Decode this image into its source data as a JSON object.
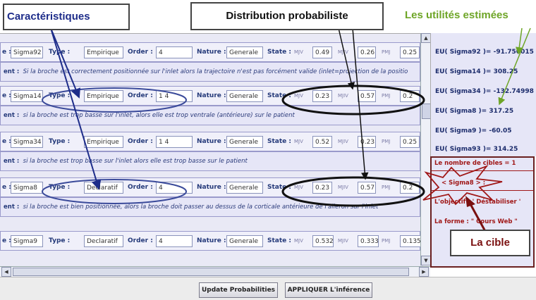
{
  "annotations": {
    "features": "Caractéristiques",
    "distribution": "Distribution probabiliste",
    "utilities": "Les utilités estimées",
    "target": "La cible"
  },
  "labels": {
    "name": "e :",
    "type": "Type :",
    "order": "Order :",
    "nature": "Nature :",
    "state": "State :",
    "mjv": "MJV",
    "mjiv": "MJIV",
    "pmj": "PMJ",
    "comment": "ent :"
  },
  "rows": [
    {
      "name": "Sigma92",
      "type": "Empirique",
      "order": "4",
      "nature": "Generale",
      "mjv": "0.49",
      "mjiv": "0.26",
      "pmj": "0.25",
      "comment": "Si la broche est correctement positionnée sur l'inlet alors la trajectoire n'est pas forcément valide (inlet=projection de la positio"
    },
    {
      "name": "Sigma14",
      "type": "Empirique",
      "order": "1 4",
      "nature": "Generale",
      "mjv": "0.23",
      "mjiv": "0.57",
      "pmj": "0.2",
      "comment": "si la broche est trop basse sur l'inlet, alors elle est trop ventrale (antérieure) sur le patient"
    },
    {
      "name": "Sigma34",
      "type": "Empirique",
      "order": "1 4",
      "nature": "Generale",
      "mjv": "0.52",
      "mjiv": "0.23",
      "pmj": "0.25",
      "comment": "si la broche est trop basse sur l'inlet alors elle est trop basse sur le patient"
    },
    {
      "name": "Sigma8",
      "type": "Declaratif",
      "order": "4",
      "nature": "Generale",
      "mjv": "0.23",
      "mjiv": "0.57",
      "pmj": "0.2",
      "comment": "si la broche est bien positionnée, alors la broche doit passer au dessus de la corticale antérieure de l'aileron sur l'inlet"
    },
    {
      "name": "Sigma9",
      "type": "Declaratif",
      "order": "4",
      "nature": "Generale",
      "mjv": "0.532",
      "mjiv": "0.333",
      "pmj": "0.135",
      "comment": ""
    }
  ],
  "utilities": [
    "EU( Sigma92 )= -91.750015",
    "EU( Sigma14 )= 308.25",
    "EU( Sigma34 )= -132.74998",
    "EU( Sigma8 )= 317.25",
    "EU( Sigma9 )= -60.05",
    "EU( Sigma93 )= 314.25"
  ],
  "target_panel": {
    "count": "Le nombre de cibles = 1",
    "sigma": "< Sigma8 > :",
    "objective": "L'objectif : ' Déstabiliser '",
    "form": "La forme : \" Cours Web \""
  },
  "buttons": {
    "update": "Update Probabilities",
    "apply": "APPLIQUER L'inférence"
  },
  "colors": {
    "accent_blue": "#1e2d8a",
    "green": "#6ea527",
    "dark_red": "#7a1010"
  }
}
